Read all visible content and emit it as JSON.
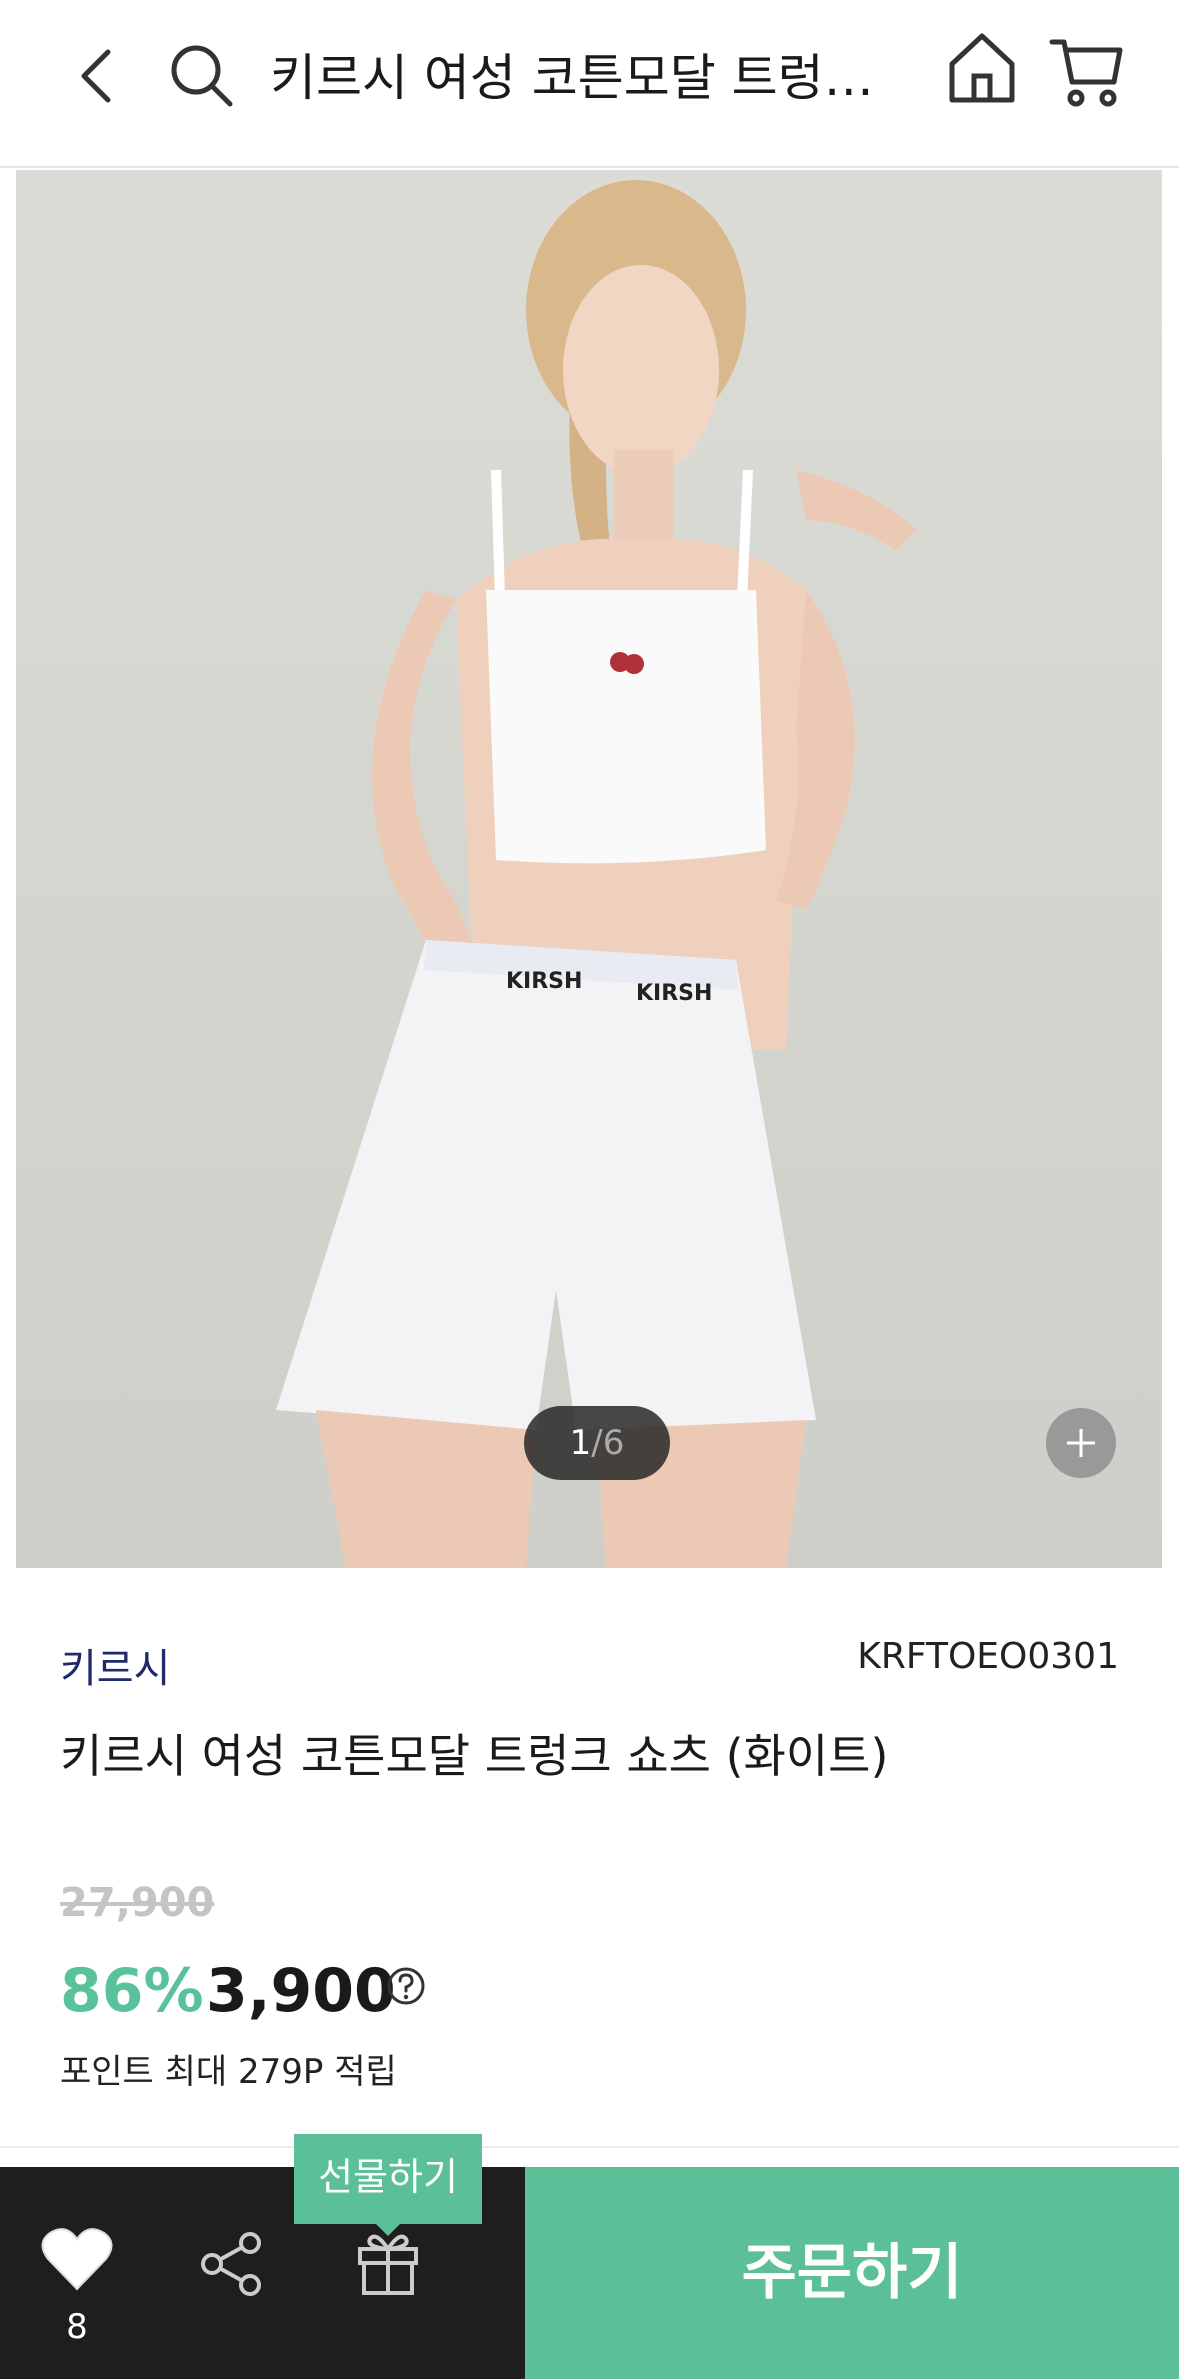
{
  "header": {
    "title": "키르시 여성 코튼모달 트렁크 쇼츠 (화이트)",
    "icons": [
      "back-arrow-icon",
      "search-icon",
      "home-icon",
      "cart-icon"
    ]
  },
  "gallery": {
    "current": "1",
    "separator": "/",
    "total": "6",
    "waistband_text": "KIRSH"
  },
  "product": {
    "brand": "키르시",
    "code": "KRFTOEO0301",
    "name": "키르시 여성 코튼모달 트렁크 쇼츠 (화이트)",
    "original_price": "27,900",
    "discount": "86%",
    "price": "3,900",
    "points": "포인트 최대 279P 적립"
  },
  "bottom_bar": {
    "likes": "8",
    "gift_label": "선물하기",
    "order_label": "주문하기"
  },
  "colors": {
    "accent": "#5bbf97",
    "brand_text": "#1f2a6b",
    "bottom_dark": "#1e1e1e"
  }
}
